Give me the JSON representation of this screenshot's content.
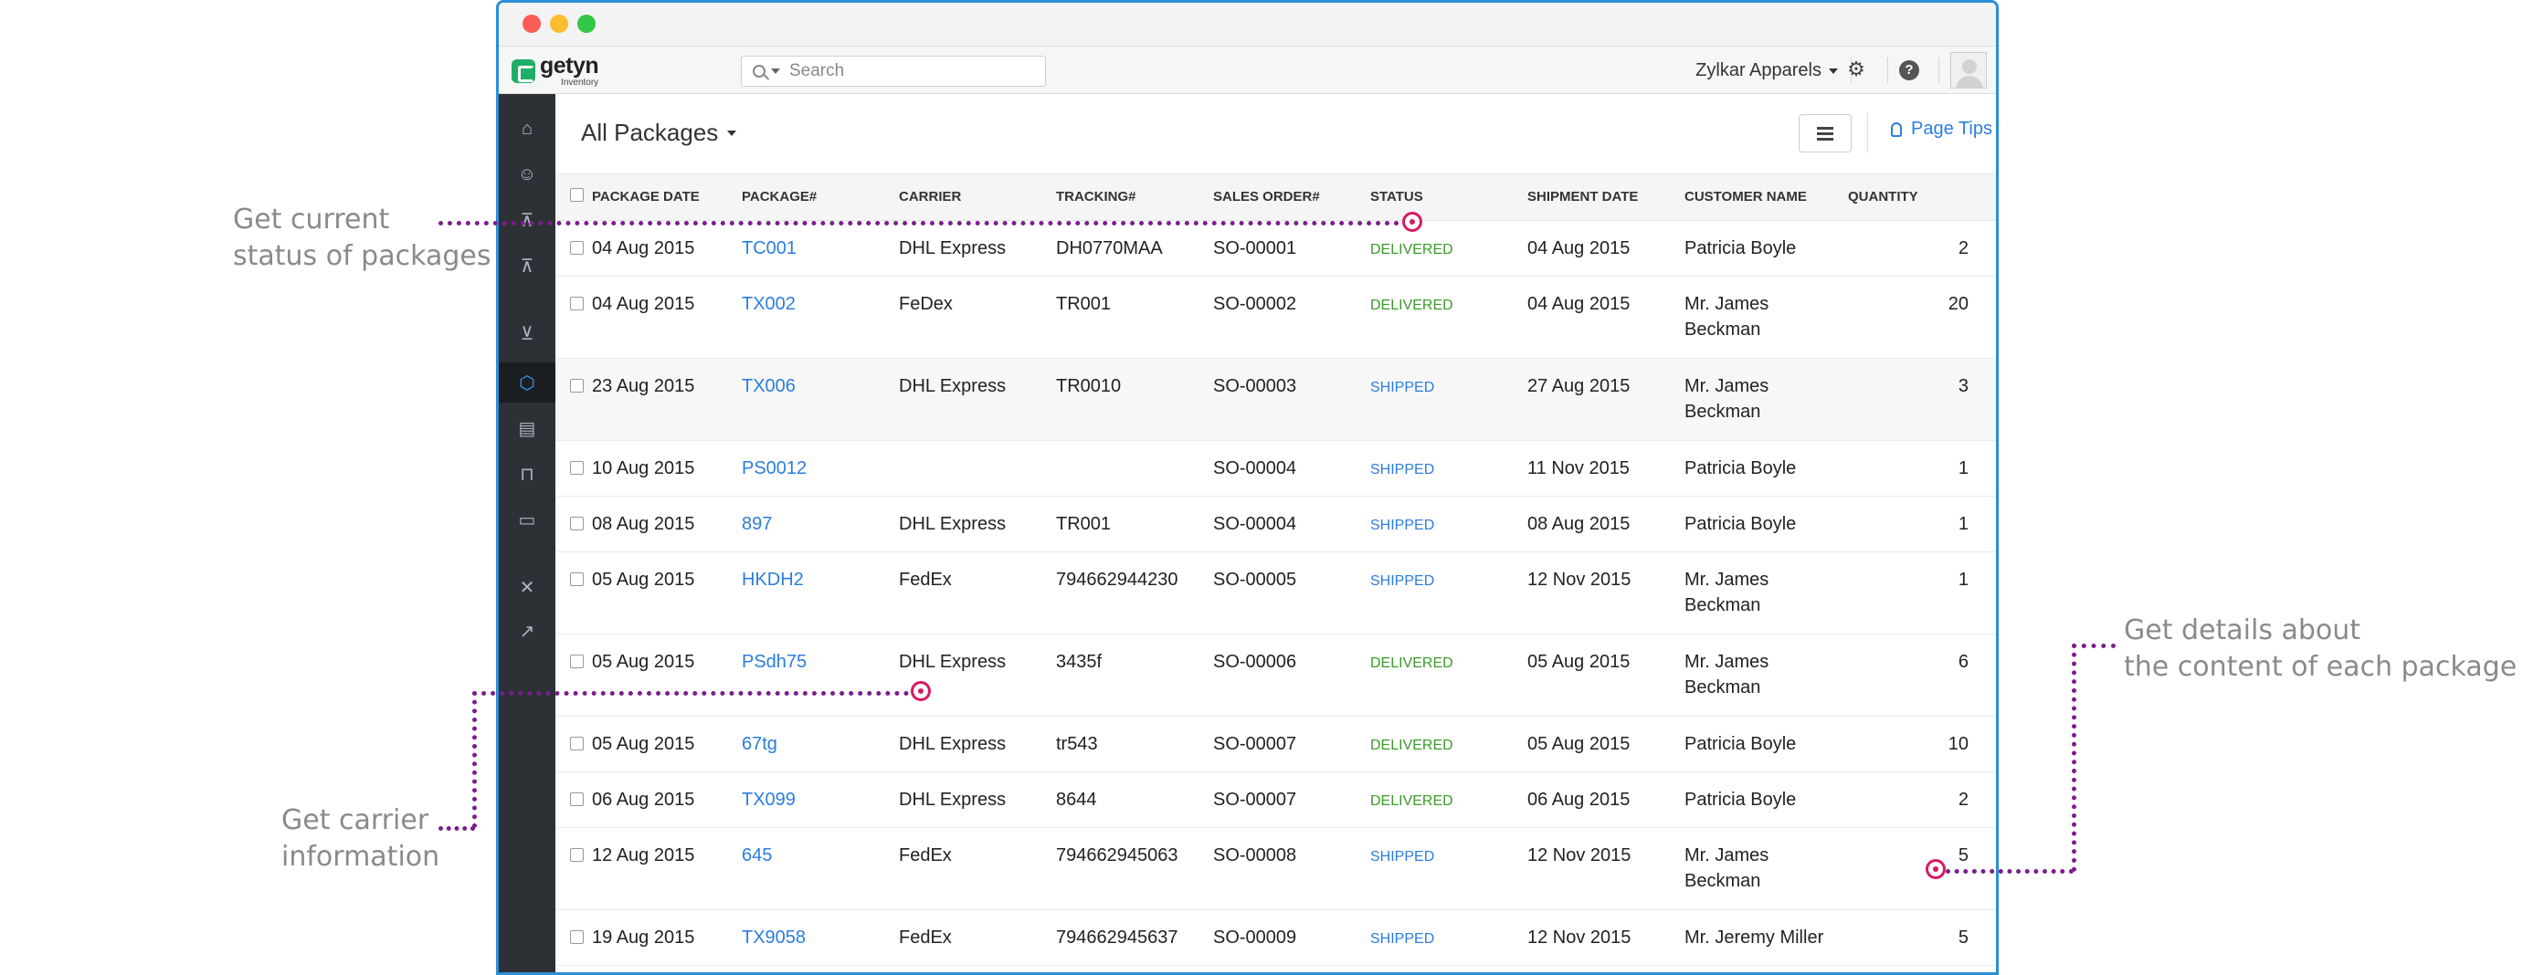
{
  "annotations": {
    "status": [
      "Get current",
      "status of packages"
    ],
    "carrier": [
      "Get carrier",
      "information"
    ],
    "details": [
      "Get details about",
      "the content of each package"
    ]
  },
  "app": {
    "logo_name": "getyn",
    "logo_sub": "Inventory",
    "search_placeholder": "Search",
    "org_name": "Zylkar Apparels"
  },
  "toolbar": {
    "view_title": "All Packages",
    "page_tips": "Page Tips"
  },
  "sidebar": {
    "icons": [
      "home-icon",
      "contacts-icon",
      "items-icon",
      "basket-icon",
      "cart-icon",
      "package-icon",
      "invoice-icon",
      "bag-icon",
      "bills-icon",
      "tools-icon",
      "reports-icon"
    ],
    "active": "package-icon"
  },
  "table": {
    "columns": [
      "PACKAGE DATE",
      "PACKAGE#",
      "CARRIER",
      "TRACKING#",
      "SALES ORDER#",
      "STATUS",
      "SHIPMENT DATE",
      "CUSTOMER NAME",
      "QUANTITY"
    ],
    "rows": [
      {
        "date": "04 Aug 2015",
        "pkg": "TC001",
        "carrier": "DHL Express",
        "tracking": "DH0770MAA",
        "so": "SO-00001",
        "status": "DELIVERED",
        "ship": "04 Aug 2015",
        "cust1": "Patricia Boyle",
        "cust2": "",
        "qty": "2"
      },
      {
        "date": "04 Aug 2015",
        "pkg": "TX002",
        "carrier": "FeDex",
        "tracking": "TR001",
        "so": "SO-00002",
        "status": "DELIVERED",
        "ship": "04 Aug 2015",
        "cust1": "Mr. James",
        "cust2": "Beckman",
        "qty": "20"
      },
      {
        "date": "23 Aug 2015",
        "pkg": "TX006",
        "carrier": "DHL Express",
        "tracking": "TR0010",
        "so": "SO-00003",
        "status": "SHIPPED",
        "ship": "27 Aug 2015",
        "cust1": "Mr. James",
        "cust2": "Beckman",
        "qty": "3"
      },
      {
        "date": "10 Aug 2015",
        "pkg": "PS0012",
        "carrier": "",
        "tracking": "",
        "so": "SO-00004",
        "status": "SHIPPED",
        "ship": "11 Nov 2015",
        "cust1": "Patricia Boyle",
        "cust2": "",
        "qty": "1"
      },
      {
        "date": "08 Aug 2015",
        "pkg": "897",
        "carrier": "DHL Express",
        "tracking": "TR001",
        "so": "SO-00004",
        "status": "SHIPPED",
        "ship": "08 Aug 2015",
        "cust1": "Patricia Boyle",
        "cust2": "",
        "qty": "1"
      },
      {
        "date": "05 Aug 2015",
        "pkg": "HKDH2",
        "carrier": "FedEx",
        "tracking": "794662944230",
        "so": "SO-00005",
        "status": "SHIPPED",
        "ship": "12 Nov 2015",
        "cust1": "Mr. James",
        "cust2": "Beckman",
        "qty": "1"
      },
      {
        "date": "05 Aug 2015",
        "pkg": "PSdh75",
        "carrier": "DHL Express",
        "tracking": "3435f",
        "so": "SO-00006",
        "status": "DELIVERED",
        "ship": "05 Aug 2015",
        "cust1": "Mr. James",
        "cust2": "Beckman",
        "qty": "6"
      },
      {
        "date": "05 Aug 2015",
        "pkg": "67tg",
        "carrier": "DHL Express",
        "tracking": "tr543",
        "so": "SO-00007",
        "status": "DELIVERED",
        "ship": "05 Aug 2015",
        "cust1": "Patricia Boyle",
        "cust2": "",
        "qty": "10"
      },
      {
        "date": "06 Aug 2015",
        "pkg": "TX099",
        "carrier": "DHL Express",
        "tracking": "8644",
        "so": "SO-00007",
        "status": "DELIVERED",
        "ship": "06 Aug 2015",
        "cust1": "Patricia Boyle",
        "cust2": "",
        "qty": "2"
      },
      {
        "date": "12 Aug 2015",
        "pkg": "645",
        "carrier": "FedEx",
        "tracking": "794662945063",
        "so": "SO-00008",
        "status": "SHIPPED",
        "ship": "12 Nov 2015",
        "cust1": "Mr. James",
        "cust2": "Beckman",
        "qty": "5"
      },
      {
        "date": "19 Aug 2015",
        "pkg": "TX9058",
        "carrier": "FedEx",
        "tracking": "794662945637",
        "so": "SO-00009",
        "status": "SHIPPED",
        "ship": "12 Nov 2015",
        "cust1": "Mr. Jeremy Miller",
        "cust2": "",
        "qty": "5"
      }
    ]
  },
  "colors": {
    "accent": "#2b7de0",
    "delivered": "#3b9a2a",
    "sidebar": "#2d3135",
    "annotation_line": "#7b1e8c",
    "annotation_marker": "#d81b60"
  }
}
